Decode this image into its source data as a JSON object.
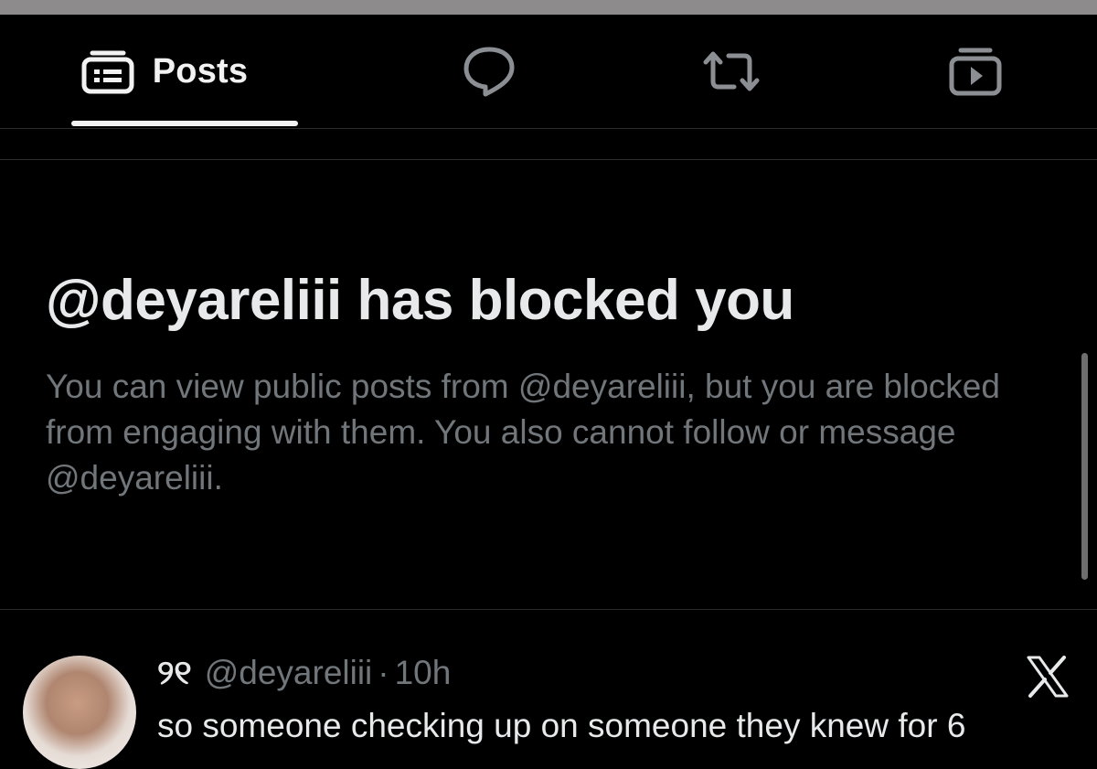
{
  "tabs": [
    {
      "id": "posts",
      "label": "Posts",
      "icon": "posts-icon",
      "selected": true
    },
    {
      "id": "replies",
      "label": "",
      "icon": "reply-bubble-icon",
      "selected": false
    },
    {
      "id": "reposts",
      "label": "",
      "icon": "repost-icon",
      "selected": false
    },
    {
      "id": "media",
      "label": "",
      "icon": "media-play-icon",
      "selected": false
    }
  ],
  "blocked": {
    "title": "@deyareliii has blocked you",
    "body": "You can view public posts from @deyareliii, but you are blocked from engaging with them. You also cannot follow or message @deyareliii."
  },
  "post": {
    "display_name": "୨୧",
    "handle": "@deyareliii",
    "separator": "·",
    "time": "10h",
    "text": "so someone checking up on someone they knew for 6",
    "source_icon": "x-logo-icon"
  },
  "colors": {
    "background": "#000000",
    "primary_text": "#e7e9ea",
    "secondary_text": "#71767b",
    "divider": "#2a2c30",
    "top_strip": "#8d8b8c"
  }
}
